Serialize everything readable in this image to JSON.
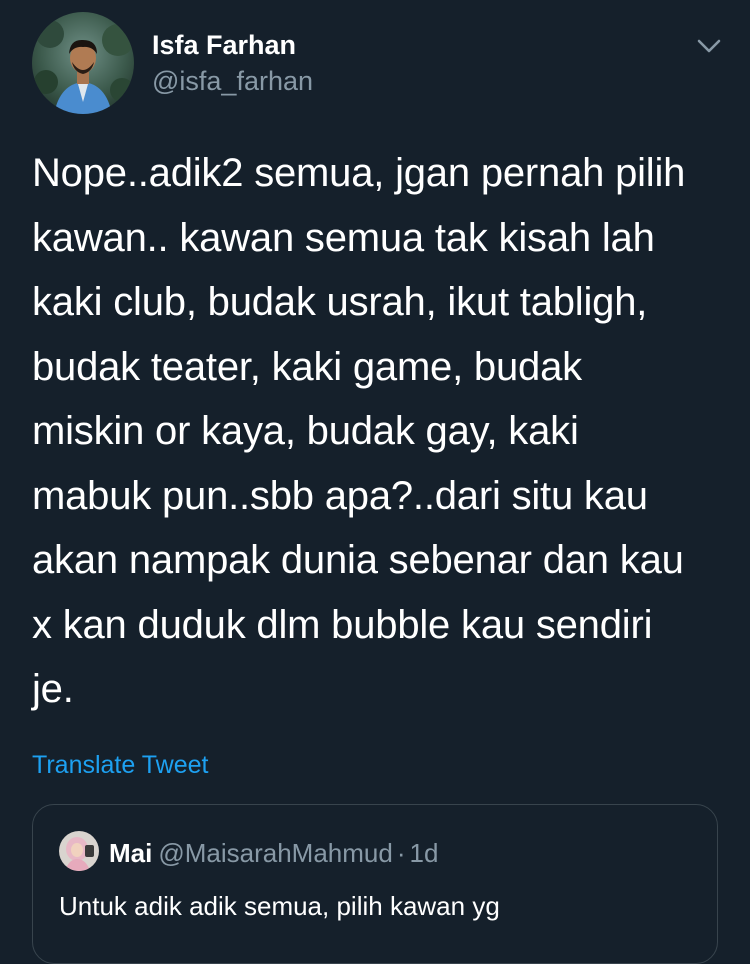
{
  "tweet": {
    "author_name": "Isfa Farhan",
    "author_handle": "@isfa_farhan",
    "menu_icon": "chevron-down-icon",
    "text": "Nope..adik2 semua, jgan pernah pilih\nkawan.. kawan semua tak kisah lah\nkaki club, budak usrah, ikut tabligh,\nbudak teater, kaki game, budak\nmiskin or kaya, budak gay, kaki\nmabuk pun..sbb apa?..dari situ kau\nakan nampak dunia sebenar dan kau\nx kan duduk dlm bubble kau sendiri\nje.",
    "translate_label": "Translate Tweet"
  },
  "quoted": {
    "author_name": "Mai",
    "author_handle": "@MaisarahMahmud",
    "separator": "·",
    "time": "1d",
    "text": "Untuk adik adik semua, pilih kawan yg"
  },
  "colors": {
    "background": "#15202b",
    "text_primary": "#ffffff",
    "text_secondary": "#8899a6",
    "accent": "#1da1f2",
    "border": "#38444d"
  }
}
